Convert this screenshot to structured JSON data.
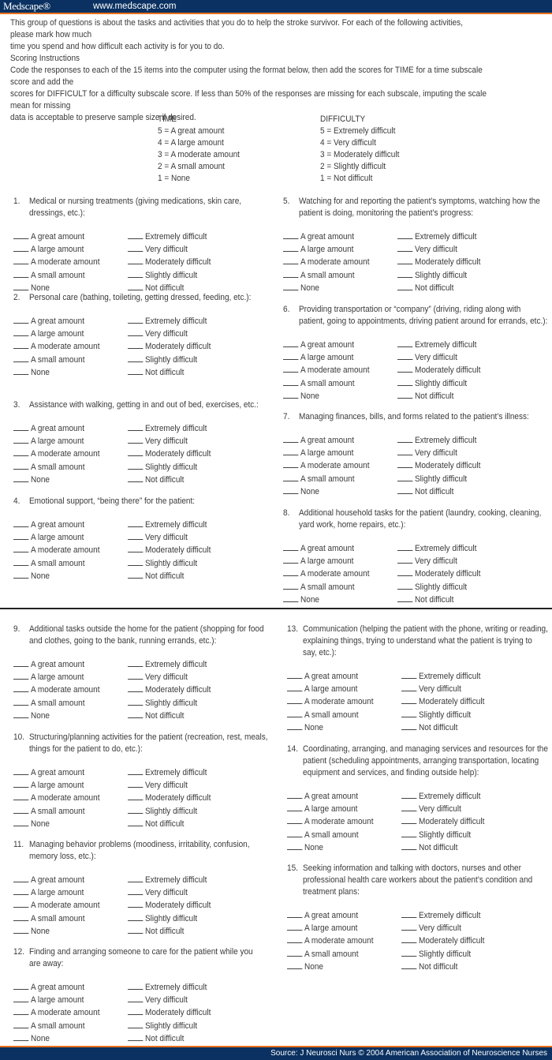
{
  "header": {
    "brand": "Medscape®",
    "url": "www.medscape.com"
  },
  "intro": "This group of questions is about the tasks and activities that you do to help the stroke survivor. For each of the following activities, please mark how much\ntime you spend and how difficult each activity is for you to do.",
  "scoring": {
    "title": "Scoring Instructions",
    "text": "Code the responses to each of the 15 items into the computer using the format below, then add the scores for TIME for a time subscale score and add the\nscores for DIFFICULT for a difficulty subscale score. If less than 50% of the responses are missing for each subscale, imputing the scale mean for missing\ndata is acceptable to preserve sample size if desired."
  },
  "legend": {
    "time": {
      "title": "TIME",
      "items": [
        "5 = A great amount",
        "4 = A large amount",
        "3 = A moderate amount",
        "2 = A small amount",
        "1 = None"
      ]
    },
    "difficulty": {
      "title": "DIFFICULTY",
      "items": [
        "5 = Extremely difficult",
        "4 = Very difficult",
        "3 = Moderately difficult",
        "2 = Slightly difficult",
        "1 = Not difficult"
      ]
    }
  },
  "time_options": [
    "A great amount",
    "A large amount",
    "A moderate amount",
    "A small amount",
    "None"
  ],
  "difficulty_options": [
    "Extremely difficult",
    "Very difficult",
    "Moderately difficult",
    "Slightly difficult",
    "Not difficult"
  ],
  "items": [
    {
      "num": "1.",
      "text": "Medical or nursing treatments (giving medications, skin care,\ndressings, etc.):"
    },
    {
      "num": "2.",
      "text": "Personal care (bathing, toileting, getting dressed, feeding, etc.):"
    },
    {
      "num": "3.",
      "text": "Assistance with walking, getting in and out of bed, exercises, etc.:"
    },
    {
      "num": "4.",
      "text": "Emotional support, “being there” for the patient:"
    },
    {
      "num": "5.",
      "text": "Watching for and reporting the patient’s symptoms, watching how the\npatient is doing, monitoring the patient’s progress:"
    },
    {
      "num": "6.",
      "text": "Providing transportation or “company” (driving, riding along with\npatient, going to appointments, driving patient around for errands, etc.):"
    },
    {
      "num": "7.",
      "text": "Managing finances, bills, and forms related to the patient’s illness:"
    },
    {
      "num": "8.",
      "text": "Additional household tasks for the patient (laundry, cooking, cleaning,\nyard work, home repairs, etc.):"
    },
    {
      "num": "9.",
      "text": "Additional tasks outside the home for the patient (shopping for food\nand clothes, going to the bank, running errands, etc.):"
    },
    {
      "num": "10.",
      "text": "Structuring/planning activities for the patient (recreation, rest, meals,\nthings for the patient to do, etc.):"
    },
    {
      "num": "11.",
      "text": "Managing behavior problems (moodiness, irritability, confusion,\nmemory loss, etc.):"
    },
    {
      "num": "12.",
      "text": "Finding and arranging someone to care for the patient while you\nare away:"
    },
    {
      "num": "13.",
      "text": "Communication (helping the patient with the phone, writing or reading,\nexplaining things, trying to understand what the patient is trying to\nsay, etc.):"
    },
    {
      "num": "14.",
      "text": "Coordinating, arranging, and managing services and resources for the\npatient (scheduling appointments, arranging transportation, locating\nequipment and services, and finding outside help):"
    },
    {
      "num": "15.",
      "text": "Seeking information and talking with doctors, nurses and other\nprofessional health care workers about the patient’s condition and\ntreatment plans:"
    }
  ],
  "footer": {
    "source": "Source: J Neurosci Nurs © 2004 American Association of Neuroscience Nurses"
  }
}
